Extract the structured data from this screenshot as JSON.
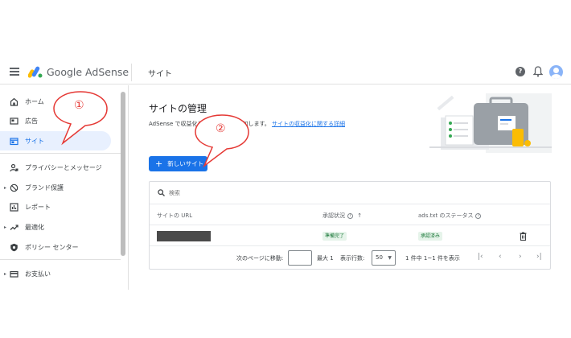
{
  "header": {
    "brand": "Google AdSense",
    "title": "サイト",
    "help_icon": "help-icon",
    "help_glyph": "?",
    "notification_icon": "bell-icon"
  },
  "sidebar": {
    "items": [
      {
        "label": "ホーム",
        "icon": "home-icon"
      },
      {
        "label": "広告",
        "icon": "ads-icon"
      },
      {
        "label": "サイト",
        "icon": "sites-icon",
        "active": true
      },
      {
        "label": "プライバシーとメッセージ",
        "icon": "privacy-icon"
      },
      {
        "label": "ブランド保護",
        "icon": "block-icon"
      },
      {
        "label": "レポート",
        "icon": "reports-icon"
      },
      {
        "label": "最適化",
        "icon": "trending-icon"
      },
      {
        "label": "ポリシー センター",
        "icon": "shield-icon"
      },
      {
        "label": "お支払い",
        "icon": "payments-icon"
      }
    ]
  },
  "main": {
    "title": "サイトの管理",
    "subtitle_text": "AdSense で収益化したいサイトを追加します。",
    "subtitle_link": "サイトの収益化に関する詳細",
    "new_site_button": "新しいサイト",
    "search_placeholder": "検索",
    "table": {
      "columns": [
        "サイトの URL",
        "承認状況",
        "ads.txt のステータス"
      ],
      "rows": [
        {
          "url": "",
          "status": "準備完了",
          "ads_txt": "承認済み"
        }
      ]
    },
    "pager": {
      "goto_label": "次のページに移動:",
      "max_label": "最大 1",
      "rows_label": "表示行数:",
      "rows_value": "50",
      "range_label": "1 件中 1~1 件を表示"
    }
  },
  "annotations": {
    "callout_1": "①",
    "callout_2": "②"
  },
  "colors": {
    "accent": "#1a73e8",
    "active_bg": "#e8f0fe",
    "success_bg": "#e6f4ea",
    "success_text": "#137333",
    "annotation": "#e53935"
  }
}
